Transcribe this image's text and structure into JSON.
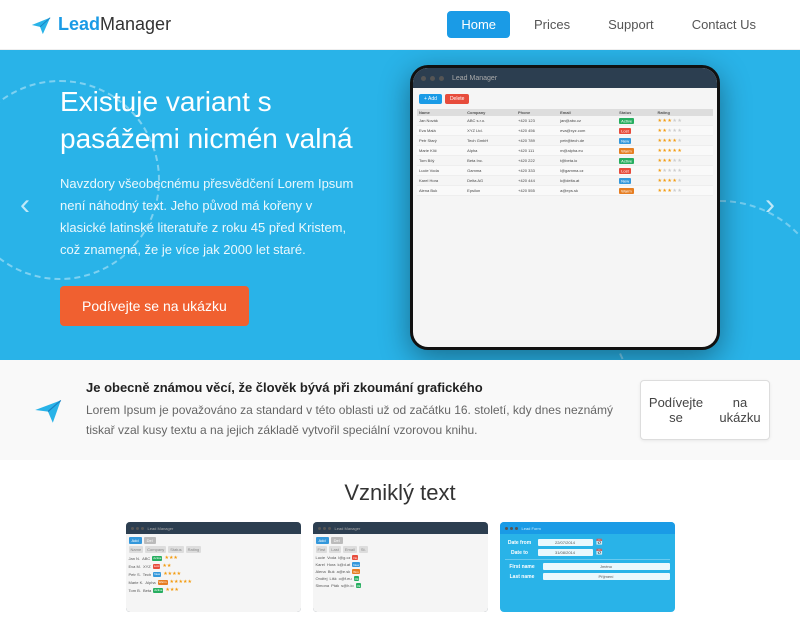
{
  "header": {
    "logo_text_lead": "Lead",
    "logo_text_manager": "Manager",
    "nav": [
      {
        "label": "Home",
        "active": true
      },
      {
        "label": "Prices",
        "active": false
      },
      {
        "label": "Support",
        "active": false
      },
      {
        "label": "Contact Us",
        "active": false
      }
    ]
  },
  "hero": {
    "title": "Existuje variant s pasážemi nicmén valná",
    "description": "Navzdory všeobecnému přesvědčení Lorem Ipsum není náhodný text. Jeho původ má kořeny v klasické latinské literatuře z roku 45 před Kristem, což znamená, že je více jak 2000 let staré.",
    "cta_label": "Podívejte se na ukázku",
    "arrow_left": "‹",
    "arrow_right": "›"
  },
  "info": {
    "heading": "Je obecně známou věcí, že člověk bývá při zkoumání grafického",
    "body": "Lorem Ipsum je považováno za standard v této oblasti už od začátku 16. století, kdy dnes neznámý tiskař vzal kusy textu a na jejich základě vytvořil speciální vzorovou knihu.",
    "btn_line1": "Podívejte se",
    "btn_line2": "na ukázku"
  },
  "features": {
    "title": "Vzniklý text",
    "cards": [
      {
        "type": "dark"
      },
      {
        "type": "dark"
      },
      {
        "type": "blue"
      }
    ]
  },
  "colors": {
    "hero_bg": "#29b3e8",
    "btn_orange": "#f06030",
    "nav_active": "#1a9be6",
    "text_dark": "#333",
    "text_light": "#666"
  }
}
